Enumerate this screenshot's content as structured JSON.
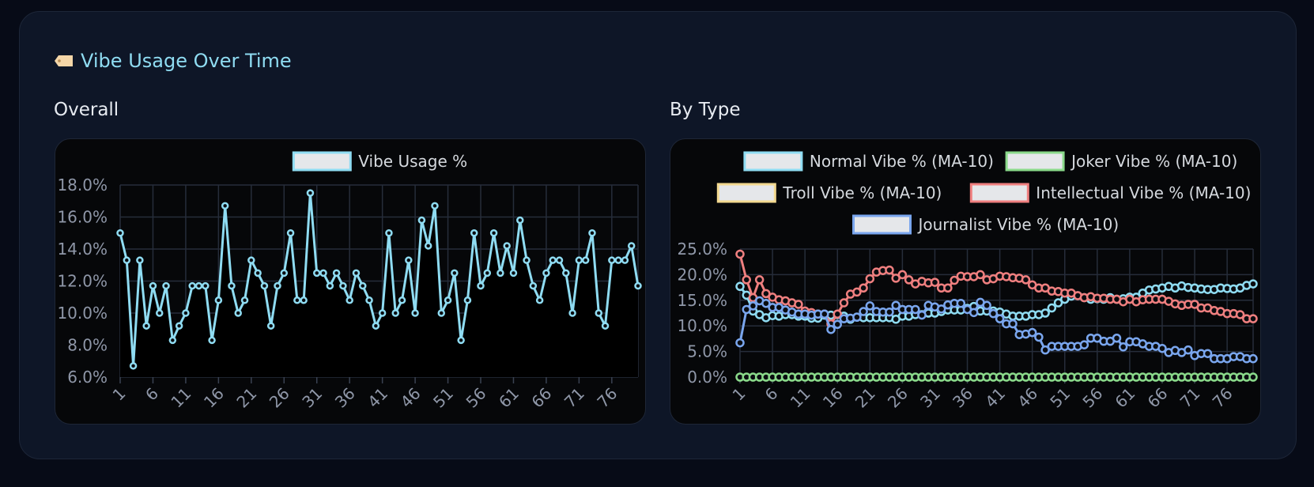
{
  "section": {
    "title": "Vibe Usage Over Time",
    "icon": "tag-icon",
    "overall_label": "Overall",
    "by_type_label": "By Type"
  },
  "chart_data": [
    {
      "type": "line",
      "title": "",
      "xlabel": "",
      "ylabel": "",
      "ylim": [
        6,
        18
      ],
      "yticks": [
        "18.0%",
        "16.0%",
        "14.0%",
        "12.0%",
        "10.0%",
        "8.0%",
        "6.0%"
      ],
      "xticks": [
        "1",
        "6",
        "11",
        "16",
        "21",
        "26",
        "31",
        "36",
        "41",
        "46",
        "51",
        "56",
        "61",
        "66",
        "71",
        "76"
      ],
      "x_range": [
        1,
        80
      ],
      "grid": true,
      "legend": "top",
      "series": [
        {
          "name": "Vibe Usage %",
          "color": "#8fdcf2",
          "fill": "#000000",
          "values": [
            15.0,
            13.3,
            6.7,
            13.3,
            9.2,
            11.7,
            10.0,
            11.7,
            8.3,
            9.2,
            10.0,
            11.7,
            11.7,
            11.7,
            8.3,
            10.8,
            16.7,
            11.7,
            10.0,
            10.8,
            13.3,
            12.5,
            11.7,
            9.2,
            11.7,
            12.5,
            15.0,
            10.8,
            10.8,
            17.5,
            12.5,
            12.5,
            11.7,
            12.5,
            11.7,
            10.8,
            12.5,
            11.7,
            10.8,
            9.2,
            10.0,
            15.0,
            10.0,
            10.8,
            13.3,
            10.0,
            15.8,
            14.2,
            16.7,
            10.0,
            10.8,
            12.5,
            8.3,
            10.8,
            15.0,
            11.7,
            12.5,
            15.0,
            12.5,
            14.2,
            12.5,
            15.8,
            13.3,
            11.7,
            10.8,
            12.5,
            13.3,
            13.3,
            12.5,
            10.0,
            13.3,
            13.3,
            15.0,
            10.0,
            9.2,
            13.3,
            13.3,
            13.3,
            14.2,
            11.7
          ]
        }
      ]
    },
    {
      "type": "line",
      "title": "",
      "xlabel": "",
      "ylabel": "",
      "ylim": [
        0,
        25
      ],
      "yticks": [
        "25.0%",
        "20.0%",
        "15.0%",
        "10.0%",
        "5.0%",
        "0.0%"
      ],
      "xticks": [
        "1",
        "6",
        "11",
        "16",
        "21",
        "26",
        "31",
        "36",
        "41",
        "46",
        "51",
        "56",
        "61",
        "66",
        "71",
        "76"
      ],
      "x_range": [
        1,
        80
      ],
      "grid": true,
      "legend": "top",
      "series": [
        {
          "name": "Normal Vibe % (MA-10)",
          "color": "#8fdcf2",
          "values": [
            17.7,
            16.0,
            12.9,
            12.2,
            11.6,
            12.0,
            11.9,
            12.2,
            12.2,
            11.9,
            11.9,
            11.5,
            11.5,
            12.1,
            12.1,
            12.2,
            11.9,
            11.3,
            11.7,
            11.6,
            11.6,
            11.6,
            11.6,
            11.6,
            11.3,
            11.9,
            11.9,
            12.2,
            12.2,
            12.5,
            12.5,
            12.8,
            13.1,
            13.1,
            13.1,
            13.4,
            13.8,
            12.9,
            12.9,
            12.9,
            12.7,
            12.3,
            11.9,
            11.9,
            11.9,
            12.2,
            12.2,
            12.5,
            13.5,
            14.5,
            15.2,
            15.8,
            15.9,
            15.5,
            15.2,
            15.3,
            15.2,
            15.5,
            15.2,
            15.3,
            15.6,
            15.6,
            16.4,
            17.0,
            17.2,
            17.4,
            17.7,
            17.4,
            17.8,
            17.5,
            17.4,
            17.2,
            17.1,
            17.1,
            17.4,
            17.3,
            17.2,
            17.4,
            17.9,
            18.2
          ]
        },
        {
          "name": "Joker Vibe % (MA-10)",
          "color": "#8ad98a",
          "values": [
            0,
            0,
            0,
            0,
            0,
            0,
            0,
            0,
            0,
            0,
            0,
            0,
            0,
            0,
            0,
            0,
            0,
            0,
            0,
            0,
            0,
            0,
            0,
            0,
            0,
            0,
            0,
            0,
            0,
            0,
            0,
            0,
            0,
            0,
            0,
            0,
            0,
            0,
            0,
            0,
            0,
            0,
            0,
            0,
            0,
            0,
            0,
            0,
            0,
            0,
            0,
            0,
            0,
            0,
            0,
            0,
            0,
            0,
            0,
            0,
            0,
            0,
            0,
            0,
            0,
            0,
            0,
            0,
            0,
            0,
            0,
            0,
            0,
            0,
            0,
            0,
            0,
            0,
            0,
            0
          ]
        },
        {
          "name": "Troll Vibe % (MA-10)",
          "color": "#f3d990",
          "values": []
        },
        {
          "name": "Intellectual Vibe % (MA-10)",
          "color": "#ef7f7f",
          "values": [
            24.0,
            19.0,
            15.5,
            19.0,
            16.3,
            15.6,
            15.1,
            14.9,
            14.5,
            14.2,
            12.9,
            12.6,
            12.3,
            12.3,
            10.4,
            12.3,
            14.5,
            16.2,
            16.6,
            17.4,
            19.2,
            20.5,
            20.8,
            20.9,
            19.3,
            20.0,
            19.0,
            18.2,
            18.7,
            18.4,
            18.5,
            17.4,
            17.4,
            18.9,
            19.7,
            19.6,
            19.6,
            20.0,
            19.0,
            19.2,
            19.7,
            19.6,
            19.4,
            19.3,
            19.0,
            18.0,
            17.4,
            17.4,
            16.8,
            16.7,
            16.4,
            16.4,
            15.9,
            15.5,
            15.7,
            15.4,
            15.4,
            15.2,
            15.2,
            14.7,
            15.2,
            14.7,
            15.1,
            15.2,
            15.2,
            15.2,
            14.8,
            14.3,
            14.0,
            14.2,
            14.2,
            13.5,
            13.5,
            13.0,
            12.8,
            12.4,
            12.4,
            12.2,
            11.4,
            11.4
          ]
        },
        {
          "name": "Journalist Vibe % (MA-10)",
          "color": "#7aa6ee",
          "values": [
            6.7,
            13.2,
            13.9,
            14.9,
            14.4,
            13.6,
            13.6,
            13.1,
            12.7,
            12.3,
            12.3,
            12.1,
            12.3,
            12.3,
            9.3,
            10.3,
            11.4,
            11.5,
            11.7,
            12.8,
            13.9,
            12.8,
            12.7,
            12.7,
            14.0,
            13.2,
            13.2,
            13.2,
            12.1,
            14.0,
            13.7,
            13.3,
            14.1,
            14.4,
            14.4,
            13.2,
            12.6,
            14.6,
            14.0,
            12.4,
            11.4,
            10.4,
            10.4,
            8.3,
            8.4,
            8.7,
            7.8,
            5.3,
            6.0,
            6.0,
            6.0,
            6.0,
            6.0,
            6.3,
            7.6,
            7.6,
            7.0,
            7.0,
            7.6,
            5.9,
            6.9,
            6.9,
            6.5,
            6.0,
            6.0,
            5.6,
            4.8,
            5.2,
            4.8,
            5.3,
            4.2,
            4.6,
            4.6,
            3.6,
            3.6,
            3.6,
            4.0,
            4.0,
            3.6,
            3.6
          ]
        }
      ]
    }
  ]
}
